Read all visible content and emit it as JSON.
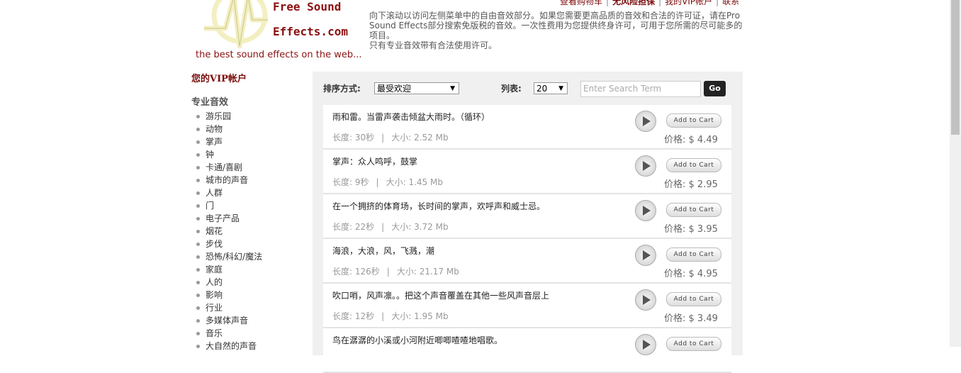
{
  "top_links": [
    "查看购物车",
    "无风险担保",
    "我的VIP帐户",
    "联系"
  ],
  "logo": {
    "line1": "Free Sound",
    "line2": "Effects.com"
  },
  "tagline": "the best sound effects on the web...",
  "intro": [
    "向下滚动以访问左侧菜单中的自由音效部分。如果您需要更高品质的音效和合法的许可证，请在Pro Sound Effects部分搜索免版税的音效。一次性费用为您提供终身许可，可用于您所需的尽可能多的项目。",
    "只有专业音效带有合法使用许可。"
  ],
  "sidebar": {
    "vip": "您的VIP帐户",
    "section": "专业音效",
    "items": [
      "游乐园",
      "动物",
      "掌声",
      "钟",
      "卡通/喜剧",
      "城市的声音",
      "人群",
      "门",
      "电子产品",
      "烟花",
      "步伐",
      "恐怖/科幻/魔法",
      "家庭",
      "人的",
      "影响",
      "行业",
      "多媒体声音",
      "音乐",
      "大自然的声音"
    ]
  },
  "toolbar": {
    "sort_label": "排序方式:",
    "sort_value": "最受欢迎",
    "list_label": "列表:",
    "list_value": "20",
    "search_placeholder": "Enter Search Term",
    "go": "Go"
  },
  "labels": {
    "duration": "长度:",
    "size": "大小:",
    "price": "价格:",
    "add": "Add to Cart"
  },
  "items": [
    {
      "title": "雨和雷。当雷声袭击倾盆大雨时。（循环）",
      "duration": "30秒",
      "size": "2.52 Mb",
      "price": "$ 4.49"
    },
    {
      "title": "掌声：众人鸣呼，鼓掌",
      "duration": "9秒",
      "size": "1.45 Mb",
      "price": "$ 2.95"
    },
    {
      "title": "在一个拥挤的体育场，长时间的掌声，欢呼声和威士忌。",
      "duration": "22秒",
      "size": "3.72 Mb",
      "price": "$ 3.95"
    },
    {
      "title": "海浪，大浪，风，飞溅，潮",
      "duration": "126秒",
      "size": "21.17 Mb",
      "price": "$ 4.95"
    },
    {
      "title": "吹口哨，风声凛。。把这个声音覆盖在其他一些风声音层上",
      "duration": "12秒",
      "size": "1.95 Mb",
      "price": "$ 3.49"
    },
    {
      "title": "鸟在潺潺的小溪或小河附近唧唧喳喳地唱歌。",
      "duration": "",
      "size": "",
      "price": ""
    }
  ]
}
